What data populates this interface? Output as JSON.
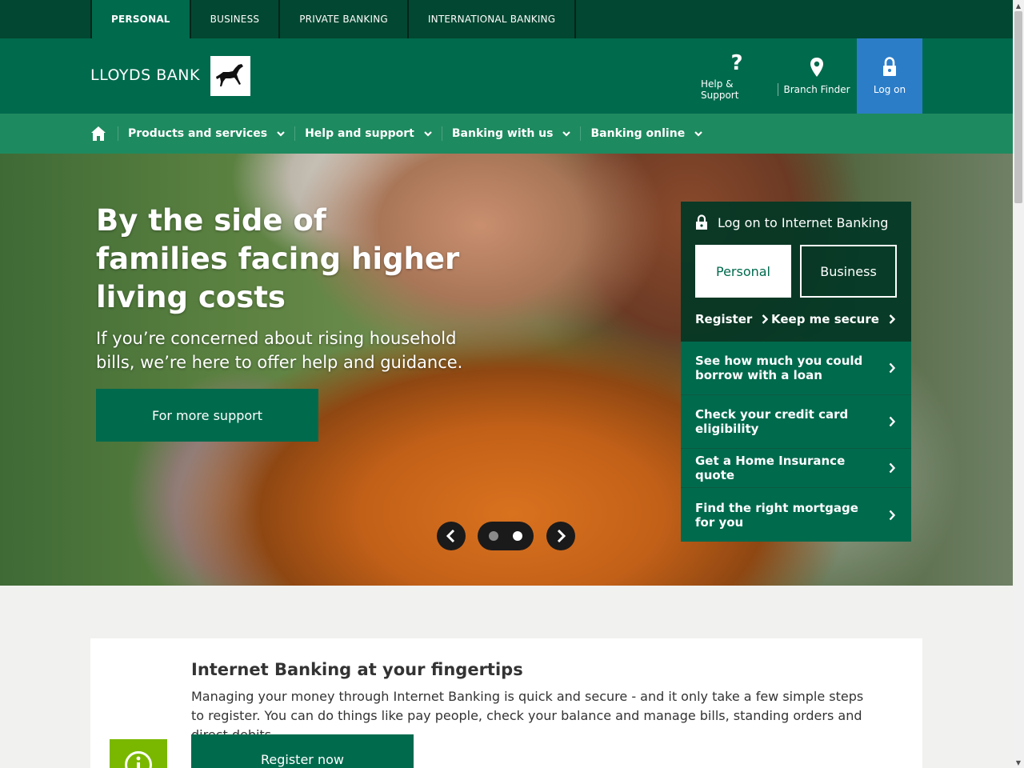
{
  "topbar": {
    "tabs": [
      {
        "label": "PERSONAL"
      },
      {
        "label": "BUSINESS"
      },
      {
        "label": "PRIVATE BANKING"
      },
      {
        "label": "INTERNATIONAL BANKING"
      }
    ]
  },
  "header": {
    "logo_text": "LLOYDS BANK",
    "help_label": "Help & Support",
    "help_icon": "?",
    "branch_label": "Branch Finder",
    "logon_label": "Log on"
  },
  "nav": {
    "items": [
      {
        "label": "Products and services"
      },
      {
        "label": "Help and support"
      },
      {
        "label": "Banking with us"
      },
      {
        "label": "Banking online"
      }
    ]
  },
  "hero": {
    "title": "By the side of families facing higher living costs",
    "subtitle": "If you’re concerned about rising household bills, we’re here to offer help and guidance.",
    "button_label": "For more support",
    "carousel_active_index": 2
  },
  "logon_panel": {
    "title": "Log on to Internet Banking",
    "personal_label": "Personal",
    "business_label": "Business",
    "register_label": "Register",
    "secure_label": "Keep me secure"
  },
  "quick_links": [
    {
      "label": "See how much you could borrow with a loan"
    },
    {
      "label": "Check your credit card eligibility"
    },
    {
      "label": "Get a Home Insurance quote"
    },
    {
      "label": "Find the right mortgage for you"
    }
  ],
  "content": {
    "title": "Internet Banking at your fingertips",
    "text": "Managing your money through Internet Banking is quick and secure - and it only take a few simple steps to register. You can do things like pay people, check your balance and manage bills, standing orders and direct debits.",
    "button_label": "Register now"
  },
  "colors": {
    "brand_dark": "#024731",
    "brand": "#006a4d",
    "nav": "#1e8a5f",
    "logon_blue": "#2b7dc8",
    "info_green": "#7ab800"
  },
  "icons": {
    "help": "question-icon",
    "branch": "map-pin-icon",
    "logon": "padlock-icon",
    "home": "home-icon",
    "info": "info-icon"
  }
}
